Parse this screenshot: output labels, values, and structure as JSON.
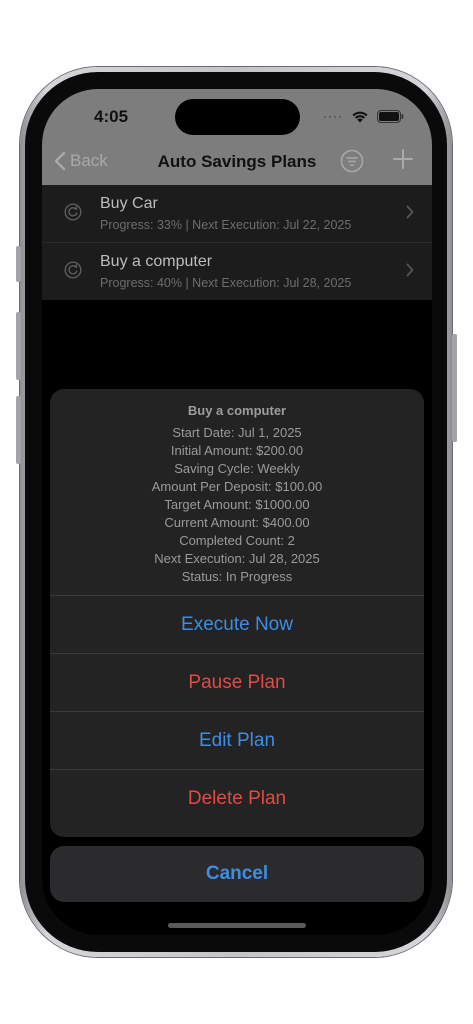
{
  "status_bar": {
    "time": "4:05",
    "signal_dots": "····"
  },
  "nav": {
    "back_label": "Back",
    "title": "Auto Savings Plans"
  },
  "plans": [
    {
      "name": "Buy Car",
      "subtitle": "Progress: 33% | Next Execution: Jul 22, 2025"
    },
    {
      "name": "Buy a computer",
      "subtitle": "Progress: 40% | Next Execution: Jul 28, 2025"
    }
  ],
  "action_sheet": {
    "title": "Buy a computer",
    "details": [
      "Start Date: Jul 1, 2025",
      "Initial Amount: $200.00",
      "Saving Cycle: Weekly",
      "Amount Per Deposit: $100.00",
      "Target Amount: $1000.00",
      "Current Amount: $400.00",
      "Completed Count: 2",
      "Next Execution: Jul 28, 2025",
      "Status: In Progress"
    ],
    "actions": {
      "execute_now": "Execute Now",
      "pause_plan": "Pause Plan",
      "edit_plan": "Edit Plan",
      "delete_plan": "Delete Plan"
    },
    "cancel": "Cancel"
  },
  "colors": {
    "accent_blue": "#3e8de4",
    "destructive_red": "#e34a44",
    "sheet_bg": "#232323"
  },
  "icons": {
    "back": "chevron-left-icon",
    "filter": "filter-icon",
    "add": "plus-icon",
    "row": "cycle-icon",
    "row_disclosure": "chevron-right-icon"
  }
}
